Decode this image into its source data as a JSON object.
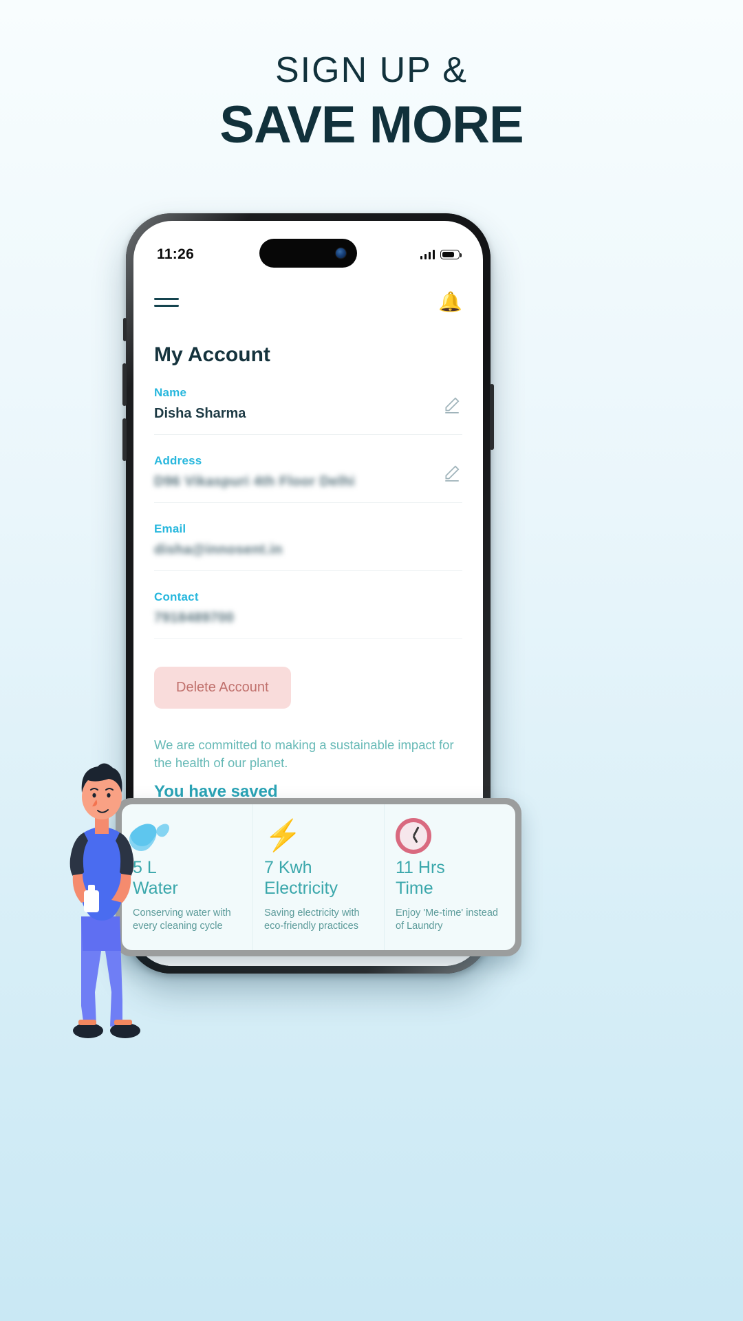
{
  "headline": {
    "line1": "SIGN UP &",
    "line2": "SAVE MORE",
    "color": "#12323c"
  },
  "phone": {
    "status_bar": {
      "time": "11:26",
      "signal_icon": "cellular-signal-icon",
      "battery_icon": "battery-icon"
    }
  },
  "app": {
    "menu_icon": "hamburger-menu-icon",
    "notification_icon": "bell-icon",
    "page_title": "My Account",
    "fields": [
      {
        "label": "Name",
        "value": "Disha Sharma",
        "blurred": false,
        "editable": true
      },
      {
        "label": "Address",
        "value": "D96  Vikaspuri  4th Floor  Delhi",
        "blurred": true,
        "editable": true
      },
      {
        "label": "Email",
        "value": "disha@innosent.in",
        "blurred": true,
        "editable": false
      },
      {
        "label": "Contact",
        "value": "7918489700",
        "blurred": true,
        "editable": false
      }
    ],
    "delete_button": "Delete Account",
    "commitment_text": "We are committed to making a sustainable impact for the health of our planet.",
    "saved_title": "You have saved",
    "accent_label_color": "#27b7dd",
    "accent_teal": "#2aa3b5",
    "delete_bg": "#f9dcdb",
    "delete_fg": "#c0706c"
  },
  "stats": [
    {
      "icon": "water-drops-icon",
      "amount": "5 L",
      "kind": "Water",
      "desc": "Conserving water with every cleaning cycle"
    },
    {
      "icon": "lightning-bolt-icon",
      "amount": "7 Kwh",
      "kind": "Electricity",
      "desc": "Saving electricity with eco-friendly practices"
    },
    {
      "icon": "clock-icon",
      "amount": "11 Hrs",
      "kind": "Time",
      "desc": "Enjoy 'Me-time' instead of Laundry"
    }
  ],
  "illustration": {
    "name": "person-holding-laundry-illustration"
  }
}
